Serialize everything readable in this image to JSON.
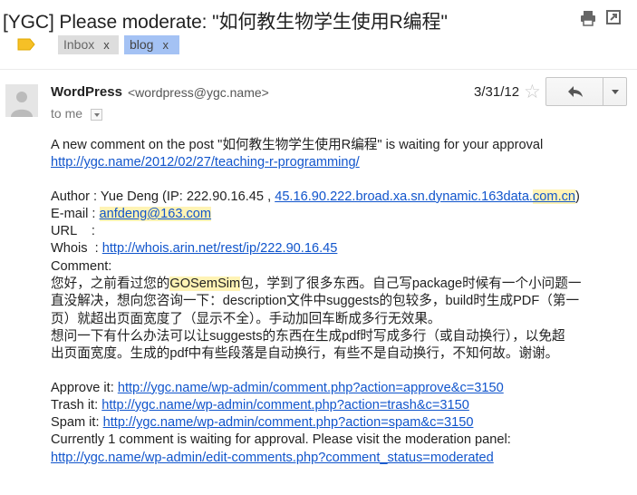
{
  "email": {
    "subject": "[YGC] Please moderate: \"如何教生物学生使用R编程\"",
    "labels": [
      {
        "name": "Inbox",
        "remove": "x"
      },
      {
        "name": "blog",
        "remove": "x"
      }
    ],
    "sender": {
      "name": "WordPress",
      "address": "<wordpress@ygc.name>",
      "to": "to me"
    },
    "date": "3/31/12",
    "icons": {
      "print": "print-icon",
      "new_window": "new-window-icon",
      "star": "star-icon",
      "reply": "reply-icon",
      "more": "chevron-down-icon",
      "label": "label-tag-icon",
      "avatar": "person-icon"
    },
    "colors": {
      "link": "#1155cc",
      "highlight": "#fff3b5",
      "label_blog": "#a4c2f4",
      "label_inbox": "#dddddd"
    }
  },
  "body": {
    "intro": "A new comment on the post \"如何教生物学生使用R编程\" is waiting for your approval",
    "post_link": "http://ygc.name/2012/02/27/teaching-r-programming/",
    "author_label": "Author : Yue Deng (IP: 222.90.16.45 , ",
    "author_host_a": "45.16.90.222.broad.xa.sn.dynamic.163data.",
    "author_host_b": "com.cn",
    "author_close": ")",
    "email_label": "E-mail : ",
    "email_value": "anfdeng@163.com",
    "url_label": "URL    :",
    "whois_label": "Whois  : ",
    "whois_link": "http://whois.arin.net/rest/ip/222.90.16.45",
    "comment_label": "Comment:",
    "comment_pre": "您好，之前看过您的",
    "comment_hl": "GOSemSim",
    "comment_line1_post": "包，学到了很多东西。自己写package时候有一个小问题一",
    "comment_line2": "直没解决，想向您咨询一下：description文件中suggests的包较多，build时生成PDF（第一",
    "comment_line3": "页）就超出页面宽度了（显示不全）。手动加回车断成多行无效果。",
    "comment_line4": "想问一下有什么办法可以让suggests的东西在生成pdf时写成多行（或自动换行），以免超",
    "comment_line5": "出页面宽度。生成的pdf中有些段落是自动换行，有些不是自动换行，不知何故。谢谢。",
    "approve_label": "Approve it: ",
    "approve_link": "http://ygc.name/wp-admin/comment.php?action=approve&c=3150",
    "trash_label": "Trash it: ",
    "trash_link": "http://ygc.name/wp-admin/comment.php?action=trash&c=3150",
    "spam_label": "Spam it: ",
    "spam_link": "http://ygc.name/wp-admin/comment.php?action=spam&c=3150",
    "pending_text": "Currently 1 comment is waiting for approval. Please visit the moderation panel:",
    "moderation_link": "http://ygc.name/wp-admin/edit-comments.php?comment_status=moderated"
  }
}
